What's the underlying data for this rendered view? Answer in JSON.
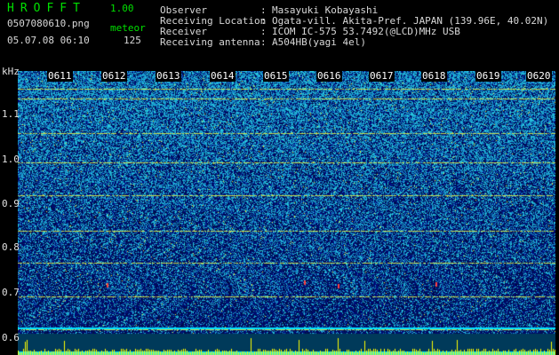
{
  "app": {
    "title": "HROFFT",
    "version": "1.00"
  },
  "file": {
    "name": "0507080610.png",
    "datetime": "05.07.08 06:10"
  },
  "meteor": {
    "label": "meteor",
    "count": "125"
  },
  "info": [
    {
      "key": "Observer",
      "value": "Masayuki Kobayashi"
    },
    {
      "key": "Receiving Location",
      "value": "Ogata-vill. Akita-Pref. JAPAN (139.96E, 40.02N)"
    },
    {
      "key": "Receiver",
      "value": "ICOM IC-575 53.7492(@LCD)MHz USB"
    },
    {
      "key": "Receiving antenna",
      "value": "A504HB(yagi 4el)"
    }
  ],
  "axis": {
    "y_unit": "kHz",
    "y_ticks": [
      "1.1",
      "1.0",
      "0.9",
      "0.8",
      "0.7",
      "0.6"
    ],
    "x_ticks": [
      "0611",
      "0612",
      "0613",
      "0614",
      "0615",
      "0616",
      "0617",
      "0618",
      "0619",
      "0620"
    ]
  },
  "colors": {
    "accent_green": "#00e000",
    "noise_low": "#00003c",
    "noise_high": "#00b4dc",
    "echo": "#ff4040",
    "amplitude_bar": "#ffff00",
    "baseline": "#00e0ff"
  }
}
